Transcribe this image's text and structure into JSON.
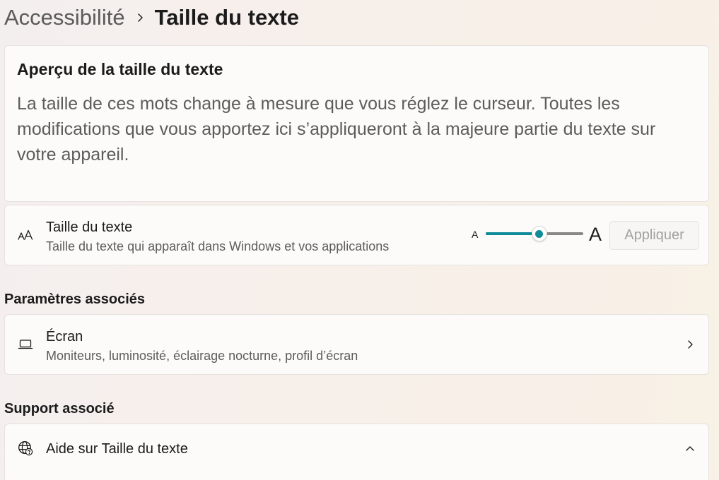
{
  "breadcrumb": {
    "parent": "Accessibilité",
    "current": "Taille du texte"
  },
  "preview": {
    "title": "Aperçu de la taille du texte",
    "text": "La taille de ces mots change à mesure que vous réglez le curseur. Toutes les modifications que vous apportez ici s’appliqueront à la majeure partie du texte sur votre appareil."
  },
  "text_size": {
    "icon": "text-size-icon",
    "title": "Taille du texte",
    "subtitle": "Taille du texte qui apparaît dans Windows et vos applications",
    "slider_small_label": "A",
    "slider_large_label": "A",
    "slider_value_fraction": 0.55,
    "apply_label": "Appliquer"
  },
  "related_settings": {
    "heading": "Paramètres associés",
    "items": [
      {
        "icon": "laptop-icon",
        "title": "Écran",
        "subtitle": "Moniteurs, luminosité, éclairage nocturne, profil d’écran"
      }
    ]
  },
  "related_support": {
    "heading": "Support associé",
    "items": [
      {
        "icon": "globe-icon",
        "title": "Aide sur Taille du texte"
      }
    ]
  },
  "colors": {
    "accent": "#0f8b99",
    "disabled_text": "#a3a1a0"
  }
}
